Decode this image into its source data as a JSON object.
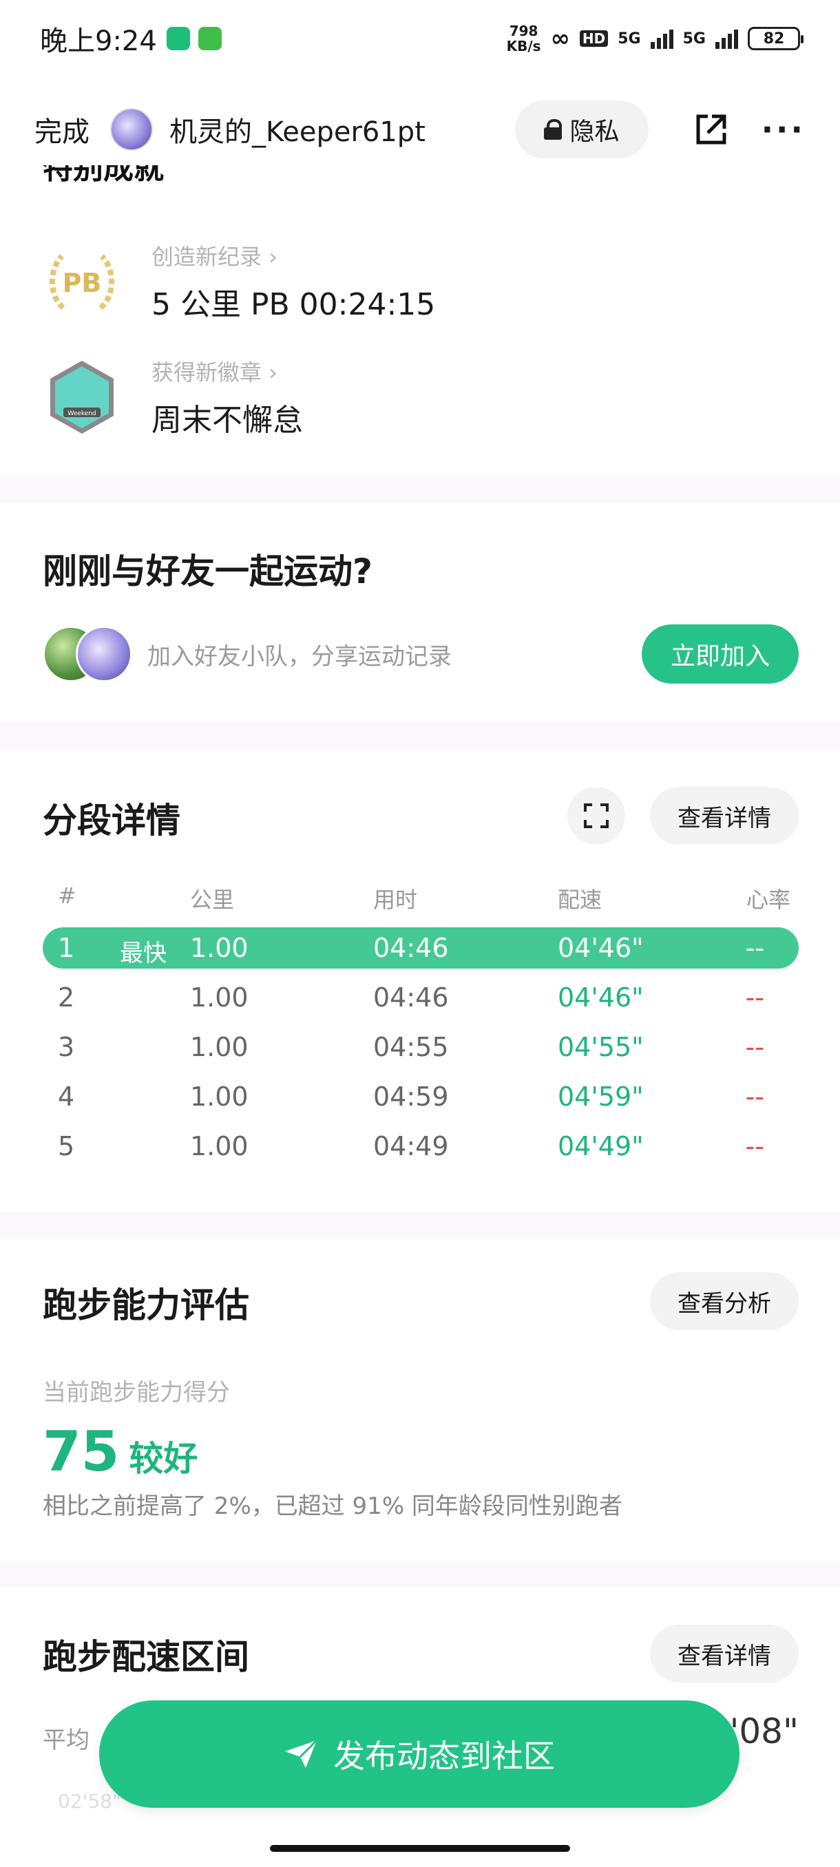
{
  "status_bar": {
    "time": "晚上9:24",
    "net_speed_value": "798",
    "net_speed_unit": "KB/s",
    "hd": "HD",
    "sim1": "5G",
    "sim2": "5G",
    "battery": "82"
  },
  "nav": {
    "done_label": "完成",
    "username": "机灵的_Keeper61pt",
    "privacy_label": "隐私"
  },
  "section_cutoff_title": "特别成就",
  "achievements": [
    {
      "sub": "创造新纪录",
      "main": "5 公里 PB 00:24:15",
      "badge_text": "PB"
    },
    {
      "sub": "获得新徽章",
      "main": "周末不懈怠",
      "badge_text": "Weekend"
    }
  ],
  "friends": {
    "title": "刚刚与好友一起运动?",
    "desc": "加入好友小队，分享运动记录",
    "join_label": "立即加入"
  },
  "splits": {
    "title": "分段详情",
    "detail_label": "查看详情",
    "headers": [
      "#",
      "公里",
      "用时",
      "配速",
      "心率"
    ],
    "fastest_tag": "最快",
    "rows": [
      {
        "idx": "1",
        "km": "1.00",
        "time": "04:46",
        "pace": "04'46\"",
        "hr": "--"
      },
      {
        "idx": "2",
        "km": "1.00",
        "time": "04:46",
        "pace": "04'46\"",
        "hr": "--"
      },
      {
        "idx": "3",
        "km": "1.00",
        "time": "04:55",
        "pace": "04'55\"",
        "hr": "--"
      },
      {
        "idx": "4",
        "km": "1.00",
        "time": "04:59",
        "pace": "04'59\"",
        "hr": "--"
      },
      {
        "idx": "5",
        "km": "1.00",
        "time": "04:49",
        "pace": "04'49\"",
        "hr": "--"
      }
    ]
  },
  "ability": {
    "title": "跑步能力评估",
    "analysis_label": "查看分析",
    "score_label": "当前跑步能力得分",
    "score": "75",
    "level": "较好",
    "desc": "相比之前提高了 2%，已超过 91% 同年龄段同性别跑者"
  },
  "pace_zone": {
    "title": "跑步配速区间",
    "detail_label": "查看详情",
    "avg_label": "平均",
    "right_value": "'08\"",
    "axis_label": "02'58\""
  },
  "publish_label": "发布动态到社区",
  "colors": {
    "accent": "#22c387",
    "pace_green": "#1fb57e",
    "hr_red": "#f04a4a"
  }
}
